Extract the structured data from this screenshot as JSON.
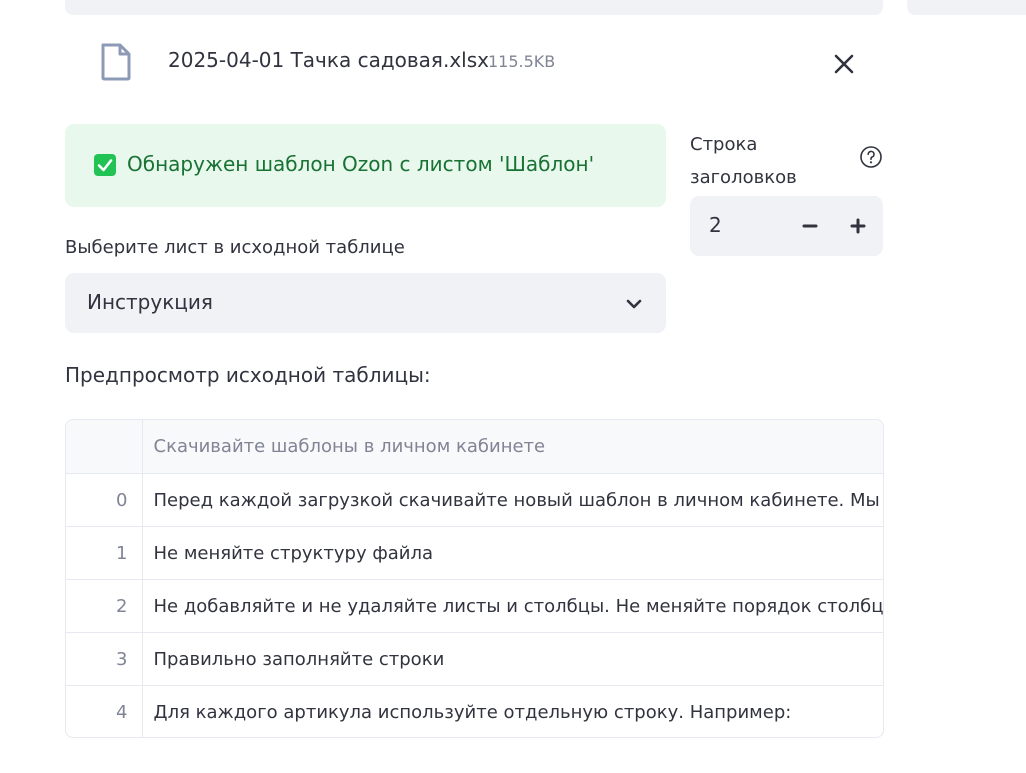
{
  "uploaded_file": {
    "name": "2025-04-01 Тачка садовая.xlsx",
    "size": "115.5KB",
    "icon": "file-icon"
  },
  "alert": {
    "text": "Обнаружен шаблон Ozon с листом 'Шаблон'",
    "icon": "checkbox-check-icon",
    "color": "#177233"
  },
  "header_row": {
    "label_line1": "Строка",
    "label_line2": "заголовков",
    "value": "2",
    "minus": "−",
    "plus": "+"
  },
  "sheet_select": {
    "label": "Выберите лист в исходной таблице",
    "value": "Инструкция"
  },
  "preview": {
    "title": "Предпросмотр исходной таблицы:",
    "columns": [
      "",
      "Скачивайте шаблоны в личном кабинете"
    ],
    "rows": [
      {
        "index": "0",
        "value": "Перед каждой загрузкой скачивайте новый шаблон в личном кабинете. Мы рег"
      },
      {
        "index": "1",
        "value": "Не меняйте структуру файла"
      },
      {
        "index": "2",
        "value": "Не добавляйте и не удаляйте листы и столбцы. Не меняйте порядок столбцов и"
      },
      {
        "index": "3",
        "value": "Правильно заполняйте строки"
      },
      {
        "index": "4",
        "value": "Для каждого артикула используйте отдельную строку. Например:"
      }
    ]
  }
}
